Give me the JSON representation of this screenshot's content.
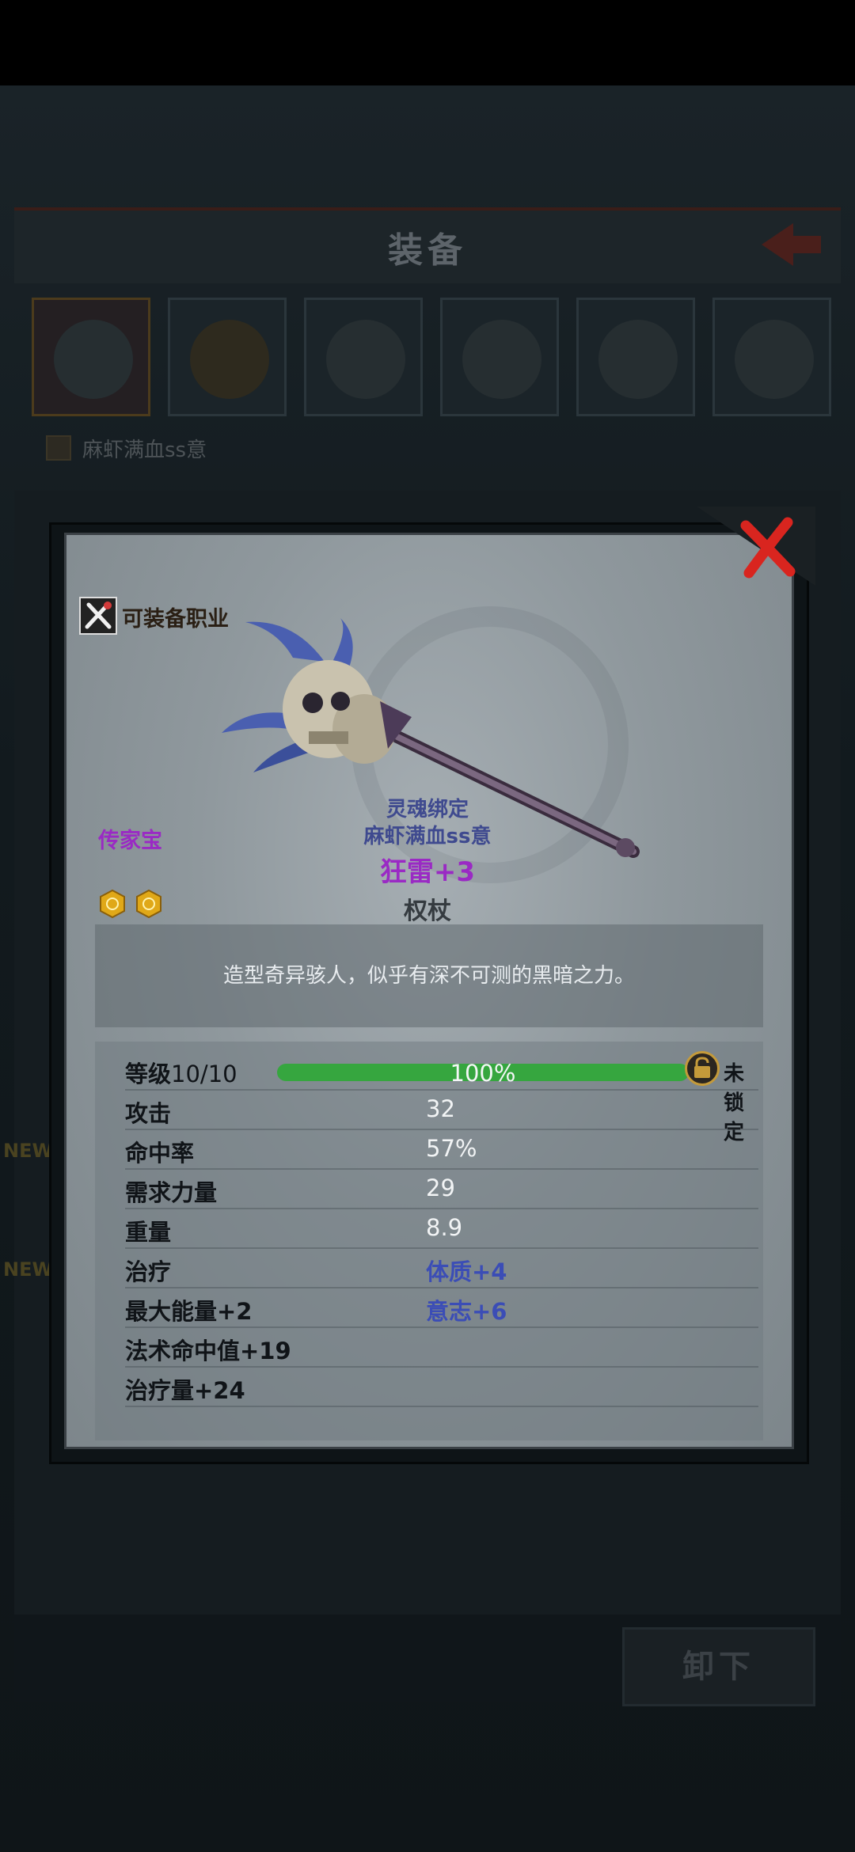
{
  "background": {
    "screen_title": "装备",
    "character_name": "麻虾满血ss意",
    "unequip_label": "卸下",
    "new_badge_1": "NEW",
    "new_badge_2": "NEW"
  },
  "item": {
    "class_label": "可装备职业",
    "rarity": "传家宝",
    "bind_status": "灵魂绑定",
    "owner": "麻虾满血ss意",
    "name": "狂雷+3",
    "type": "权杖",
    "gem_slots": 2,
    "description": "造型奇异骇人，似乎有深不可测的黑暗之力。",
    "level": {
      "label": "等级",
      "value": "10/10",
      "progress_text": "100%",
      "progress_fraction": 1.0,
      "lock_status": "未锁定"
    },
    "stats": [
      {
        "label": "攻击",
        "value": "32"
      },
      {
        "label": "命中率",
        "value": "57%"
      },
      {
        "label": "需求力量",
        "value": "29"
      },
      {
        "label": "重量",
        "value": "8.9"
      },
      {
        "label": "治疗",
        "value": "体质+4"
      },
      {
        "label": "最大能量+2",
        "value": "意志+6"
      },
      {
        "label": "法术命中值+19",
        "value": ""
      },
      {
        "label": "治疗量+24",
        "value": ""
      }
    ]
  },
  "icons": {
    "close": "close-x-icon",
    "class": "crossed-weapons-icon",
    "lock": "padlock-icon",
    "gem": "gem-slot-icon"
  },
  "colors": {
    "rarity_purple": "#9a2ac4",
    "bound_blue": "#3f4a8f",
    "bonus_blue": "#3b4db6",
    "progress_green": "#36a63f",
    "close_red": "#d9251f"
  }
}
